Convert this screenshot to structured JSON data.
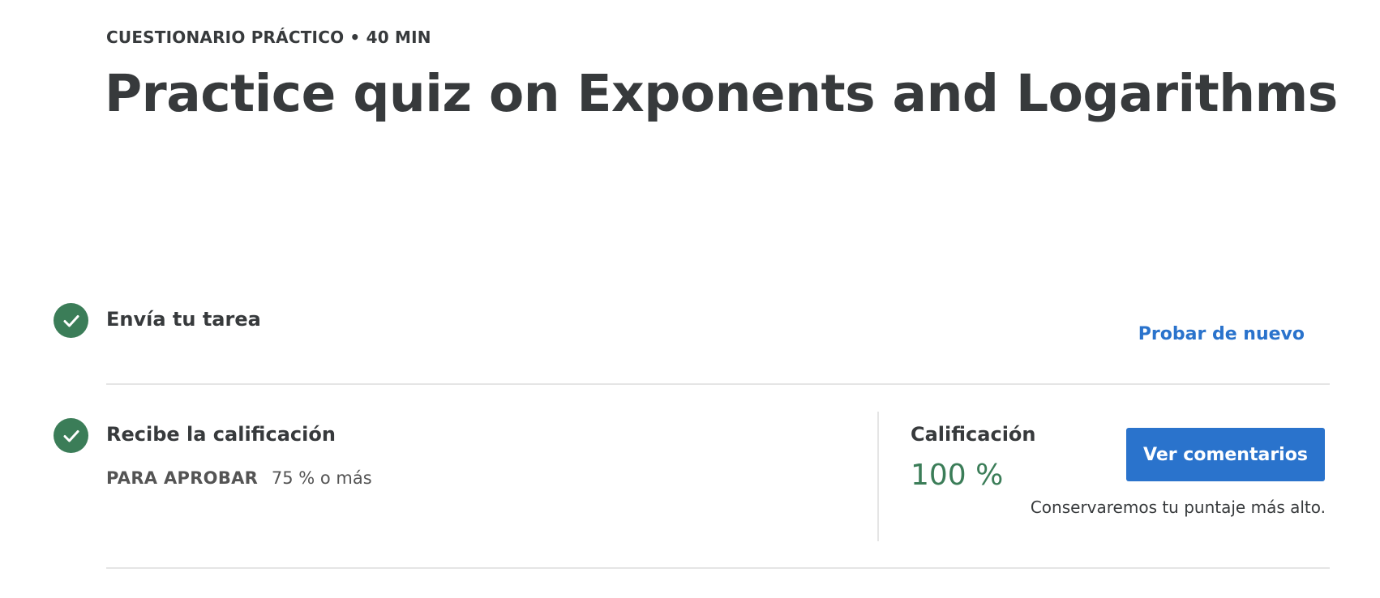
{
  "header": {
    "eyebrow": "CUESTIONARIO PRÁCTICO • 40 MIN",
    "title": "Practice quiz on Exponents and Logarithms"
  },
  "steps": [
    {
      "title": "Envía tu tarea",
      "status": "completed",
      "action_label": "Probar de nuevo"
    },
    {
      "title": "Recibe la calificación",
      "status": "completed",
      "pass_label": "PARA APROBAR",
      "pass_value": "75 % o más"
    }
  ],
  "grade": {
    "label": "Calificación",
    "value": "100 %",
    "button_label": "Ver comentarios",
    "note": "Conservaremos tu puntaje más alto."
  },
  "colors": {
    "accent": "#2a73cc",
    "success": "#3b7d58",
    "text": "#373a3c",
    "divider": "#e5e5e5"
  }
}
